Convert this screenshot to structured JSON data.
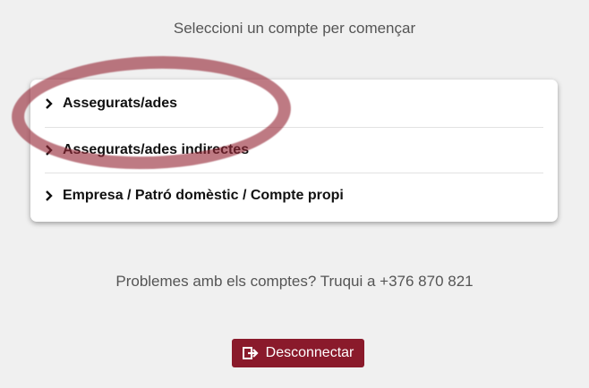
{
  "header": {
    "title": "Seleccioni un compte per començar"
  },
  "accounts": {
    "items": [
      {
        "label": "Assegurats/ades",
        "icon": "chevron-right-icon"
      },
      {
        "label": "Assegurats/ades indirectes",
        "icon": "chevron-right-icon"
      },
      {
        "label": "Empresa / Patró domèstic / Compte propi",
        "icon": "chevron-right-icon"
      }
    ]
  },
  "support": {
    "text": "Problemes amb els comptes? Truqui a +376 870 821"
  },
  "logout": {
    "label": "Desconnectar",
    "icon": "sign-out-icon"
  },
  "colors": {
    "brand": "#8a1a2b",
    "background": "#f0f0f0",
    "highlight": "#962837"
  }
}
